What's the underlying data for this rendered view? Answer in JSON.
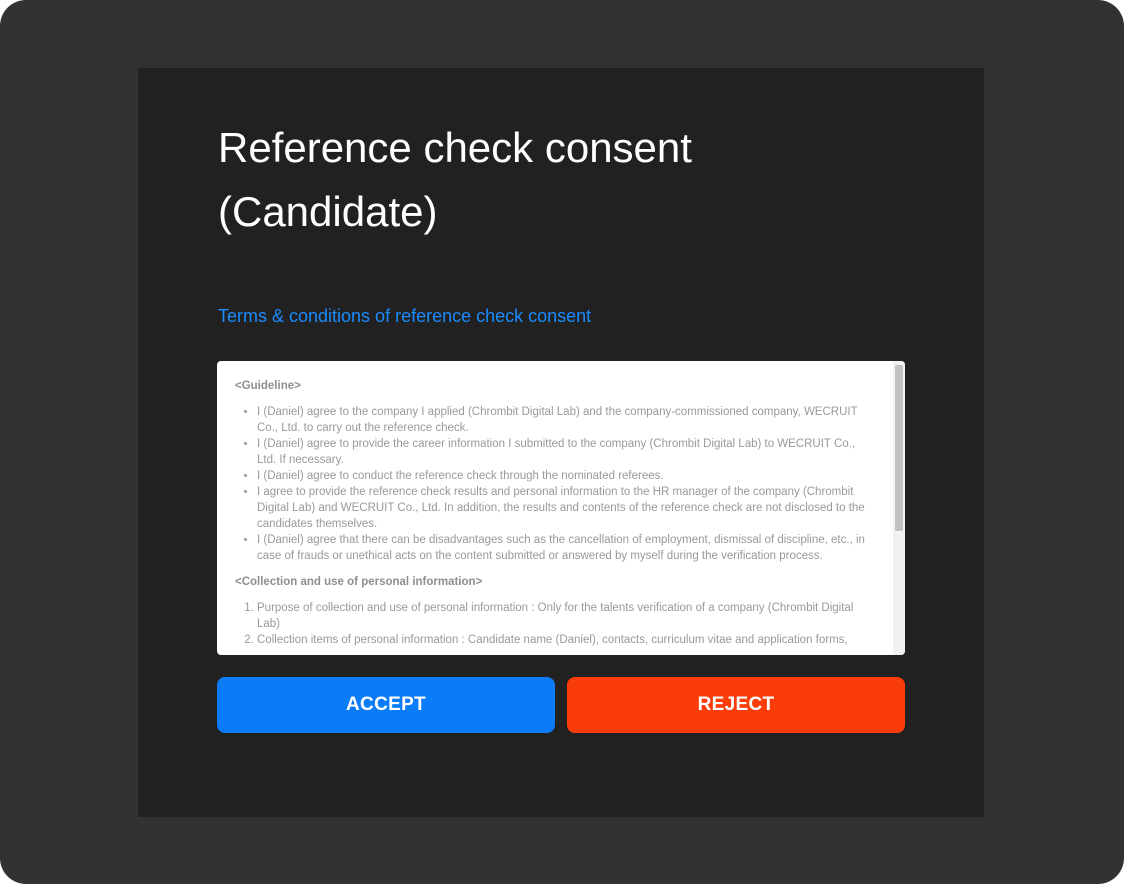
{
  "dialog": {
    "title_line1": "Reference check consent",
    "title_line2": "(Candidate)",
    "terms_link": "Terms & conditions of reference check consent"
  },
  "terms": {
    "guideline_heading": "<Guideline>",
    "guideline_items": [
      "I (Daniel) agree to the company I applied (Chrombit Digital Lab) and the company-commissioned company, WECRUIT Co., Ltd. to carry out the reference check.",
      "I (Daniel) agree to provide the career information I submitted to the company (Chrombit Digital Lab) to WECRUIT Co., Ltd. If necessary.",
      "I (Daniel) agree to conduct the reference check through the nominated referees.",
      "I agree to provide the reference check results and personal information to the HR manager of the company (Chrombit Digital Lab) and WECRUIT Co., Ltd. In addition, the results and contents of the reference check are not disclosed to the candidates themselves.",
      "I (Daniel) agree that there can be disadvantages such as the cancellation of employment, dismissal of discipline, etc., in case of frauds or unethical acts on the content submitted or answered by myself during the verification process."
    ],
    "collection_heading": "<Collection and use of personal information>",
    "collection_items": [
      "Purpose of collection and use of personal information : Only for the talents verification of a company (Chrombit Digital Lab)",
      "Collection items of personal information : Candidate name (Daniel), contacts, curriculum vitae and application forms,"
    ]
  },
  "buttons": {
    "accept": "ACCEPT",
    "reject": "REJECT"
  },
  "colors": {
    "outer_bg": "#323232",
    "panel_bg": "#212121",
    "link": "#1a8cff",
    "accept": "#0a7cf8",
    "reject": "#fa3c08"
  }
}
